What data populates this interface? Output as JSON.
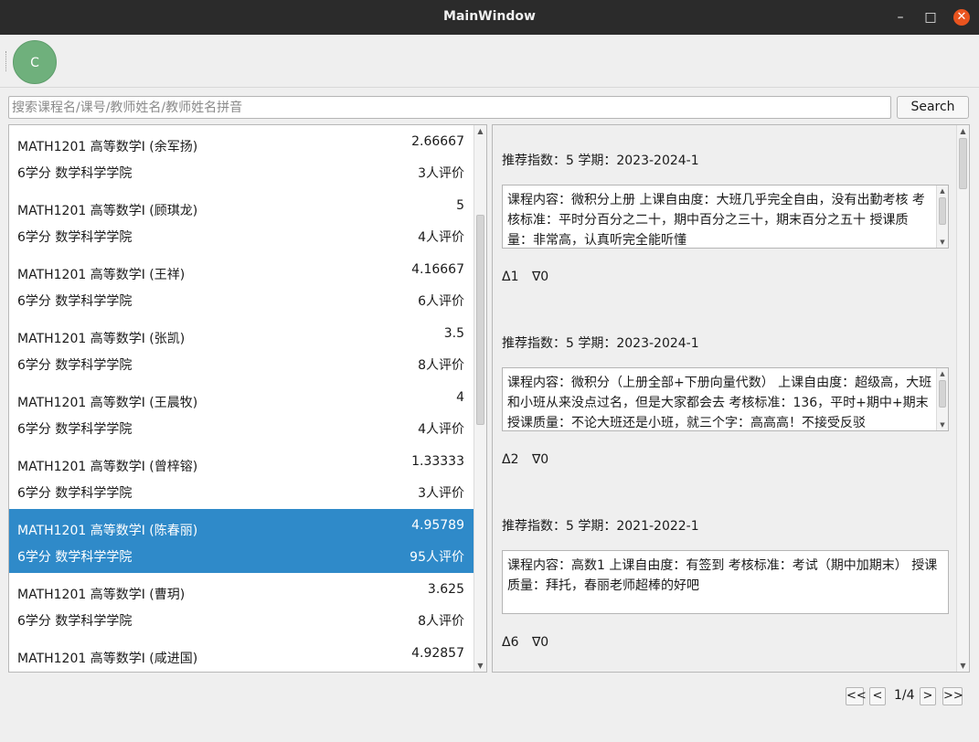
{
  "window": {
    "title": "MainWindow"
  },
  "toolbar": {
    "avatar_letter": "C"
  },
  "search": {
    "placeholder": "搜索课程名/课号/教师姓名/教师姓名拼音",
    "button_label": "Search"
  },
  "courses": [
    {
      "title": "MATH1201 高等数学I (余军扬)",
      "score": "2.66667",
      "sub": "6学分 数学科学学院",
      "count": "3人评价"
    },
    {
      "title": "MATH1201 高等数学I (顾琪龙)",
      "score": "5",
      "sub": "6学分 数学科学学院",
      "count": "4人评价"
    },
    {
      "title": "MATH1201 高等数学I (王祥)",
      "score": "4.16667",
      "sub": "6学分 数学科学学院",
      "count": "6人评价"
    },
    {
      "title": "MATH1201 高等数学I (张凯)",
      "score": "3.5",
      "sub": "6学分 数学科学学院",
      "count": "8人评价"
    },
    {
      "title": "MATH1201 高等数学I (王晨牧)",
      "score": "4",
      "sub": "6学分 数学科学学院",
      "count": "4人评价"
    },
    {
      "title": "MATH1201 高等数学I (曾梓镕)",
      "score": "1.33333",
      "sub": "6学分 数学科学学院",
      "count": "3人评价"
    },
    {
      "title": "MATH1201 高等数学I (陈春丽)",
      "score": "4.95789",
      "sub": "6学分 数学科学学院",
      "count": "95人评价"
    },
    {
      "title": "MATH1201 高等数学I (曹玥)",
      "score": "3.625",
      "sub": "6学分 数学科学学院",
      "count": "8人评价"
    },
    {
      "title": "MATH1201 高等数学I (咸进国)",
      "score": "4.92857",
      "sub": "",
      "count": ""
    }
  ],
  "reviews": [
    {
      "meta": "推荐指数：5  学期：2023-2024-1",
      "content": "课程内容：微积分上册 上课自由度：大班几乎完全自由，没有出勤考核 考核标准：平时分百分之二十，期中百分之三十，期末百分之五十 授课质量：非常高，认真听完全能听懂",
      "up": "Δ1",
      "down": "∇0"
    },
    {
      "meta": "推荐指数：5  学期：2023-2024-1",
      "content": "课程内容：微积分（上册全部+下册向量代数） 上课自由度：超级高，大班和小班从来没点过名，但是大家都会去 考核标准：136，平时+期中+期末 授课质量：不论大班还是小班，就三个字：高高高！不接受反驳",
      "up": "Δ2",
      "down": "∇0"
    },
    {
      "meta": "推荐指数：5  学期：2021-2022-1",
      "content": "课程内容：高数1 上课自由度：有签到 考核标准：考试（期中加期末） 授课质量：拜托，春丽老师超棒的好吧",
      "up": "Δ6",
      "down": "∇0"
    }
  ],
  "pager": {
    "first": "<<",
    "prev": "<",
    "label": "1/4",
    "next": ">",
    "last": ">>"
  },
  "colors": {
    "titlebar": "#2b2b2b",
    "close": "#e9541f",
    "selected_row": "#2f8ac9",
    "avatar": "#6fb07c"
  }
}
